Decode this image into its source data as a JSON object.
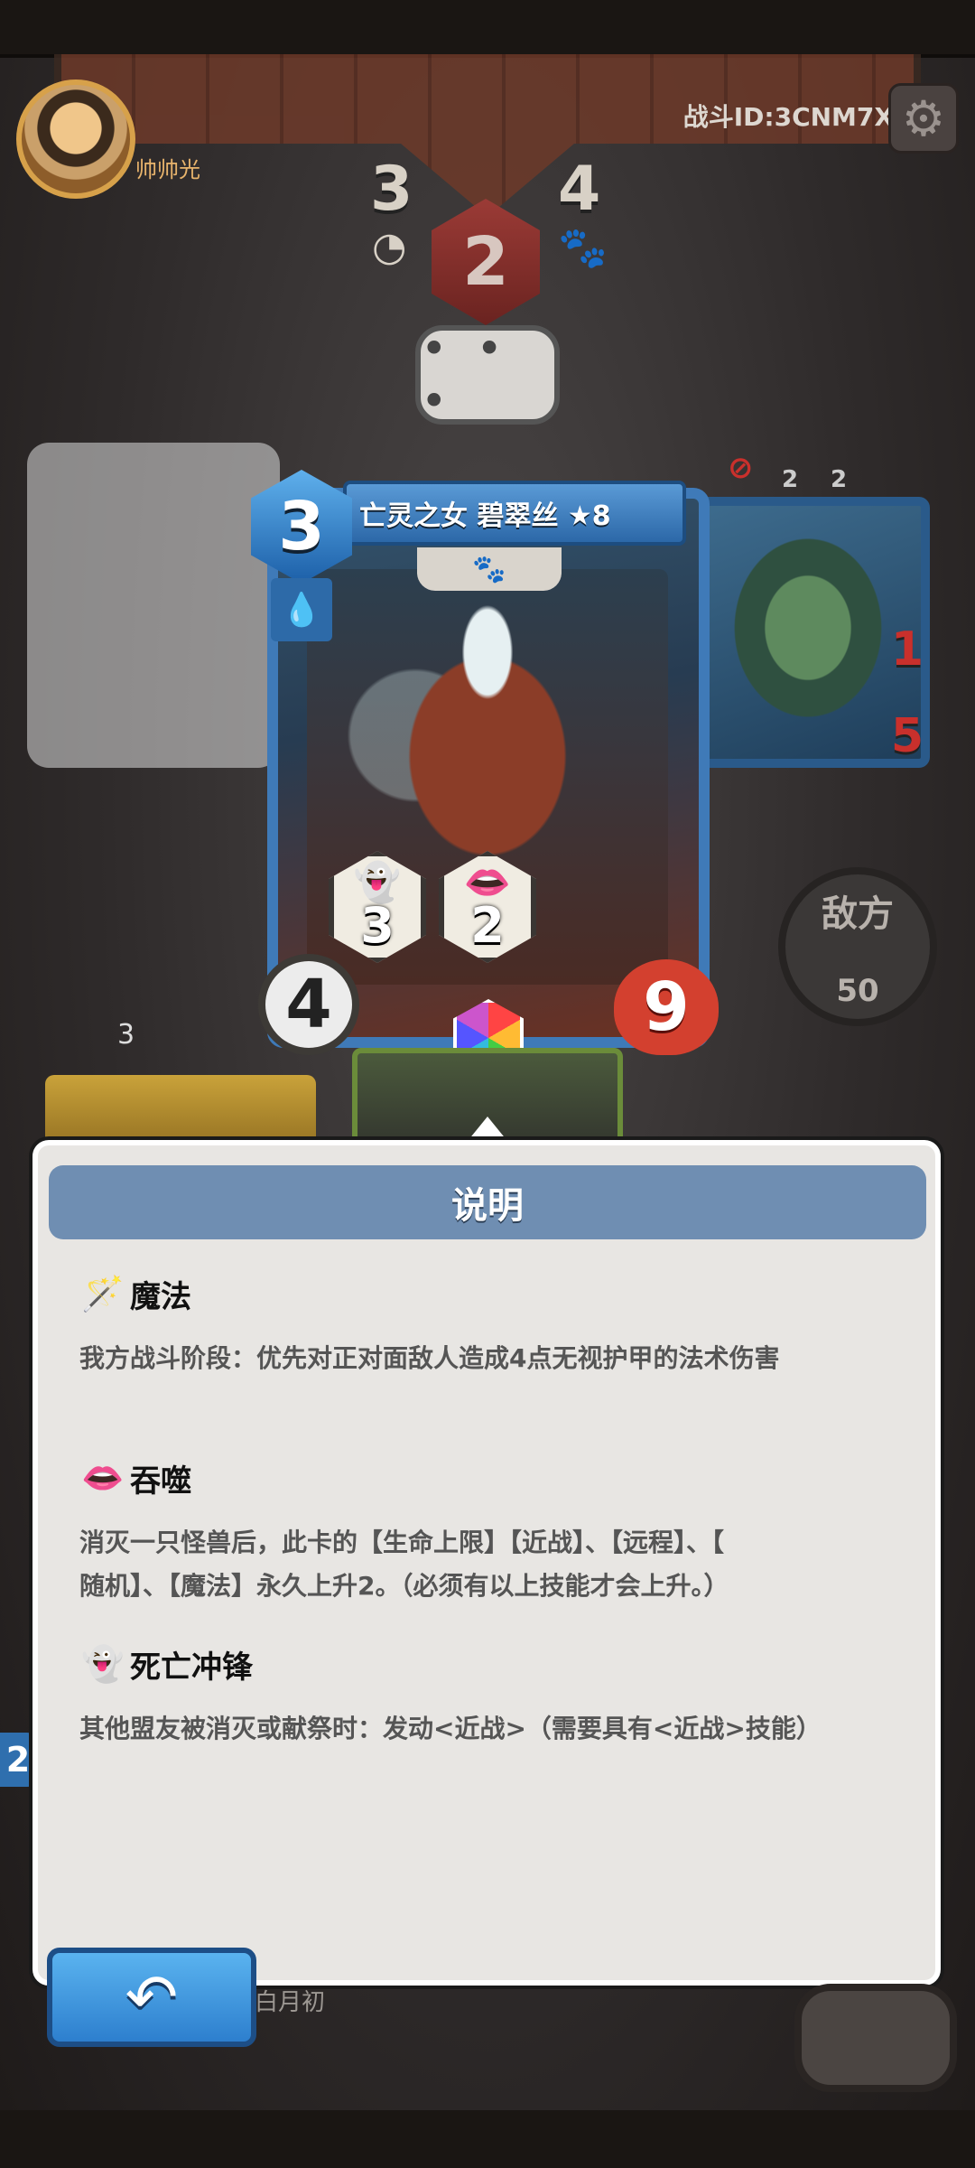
{
  "header": {
    "player_name": "帅帅光",
    "battle_id": "战斗ID:3CNM7X",
    "settings_icon": "gear-icon"
  },
  "top_stats": {
    "left_value": "3",
    "left_icon": "ring-icon",
    "center_value": "2",
    "right_value": "4",
    "right_icon": "paw-icon",
    "chat_text": "• • •"
  },
  "enemy": {
    "label": "敌方",
    "value": "50",
    "card_attack": "1",
    "card_hp": "5",
    "status_counts": [
      "2",
      "2"
    ]
  },
  "card": {
    "cost": "3",
    "title": "亡灵之女 碧翠丝 ★8",
    "tribe_icon": "paw-icon",
    "element_icon": "water-drop-icon",
    "attack": "4",
    "hp": "9",
    "skills": [
      {
        "icon": "ghost-icon",
        "value": "3"
      },
      {
        "icon": "devour-mouth-icon",
        "value": "2"
      }
    ]
  },
  "bottom": {
    "left_card_stat": "3",
    "self_name": "白月初",
    "left_side_number": "2"
  },
  "dialog": {
    "title": "说明",
    "skills": [
      {
        "icon": "magic-staff-icon",
        "name": "魔法",
        "desc": "我方战斗阶段：优先对正对面敌人造成4点无视护甲的法术伤害"
      },
      {
        "icon": "devour-mouth-icon",
        "name": "吞噬",
        "desc": "消灭一只怪兽后，此卡的【生命上限】【近战】、【远程】、【\n随机】、【魔法】永久上升2。（必须有以上技能才会上升。）"
      },
      {
        "icon": "ghost-icon",
        "name": "死亡冲锋",
        "desc": "其他盟友被消灭或献祭时：发动<近战>（需要具有<近战>技能）"
      }
    ],
    "back_icon": "back-arrow-icon"
  }
}
